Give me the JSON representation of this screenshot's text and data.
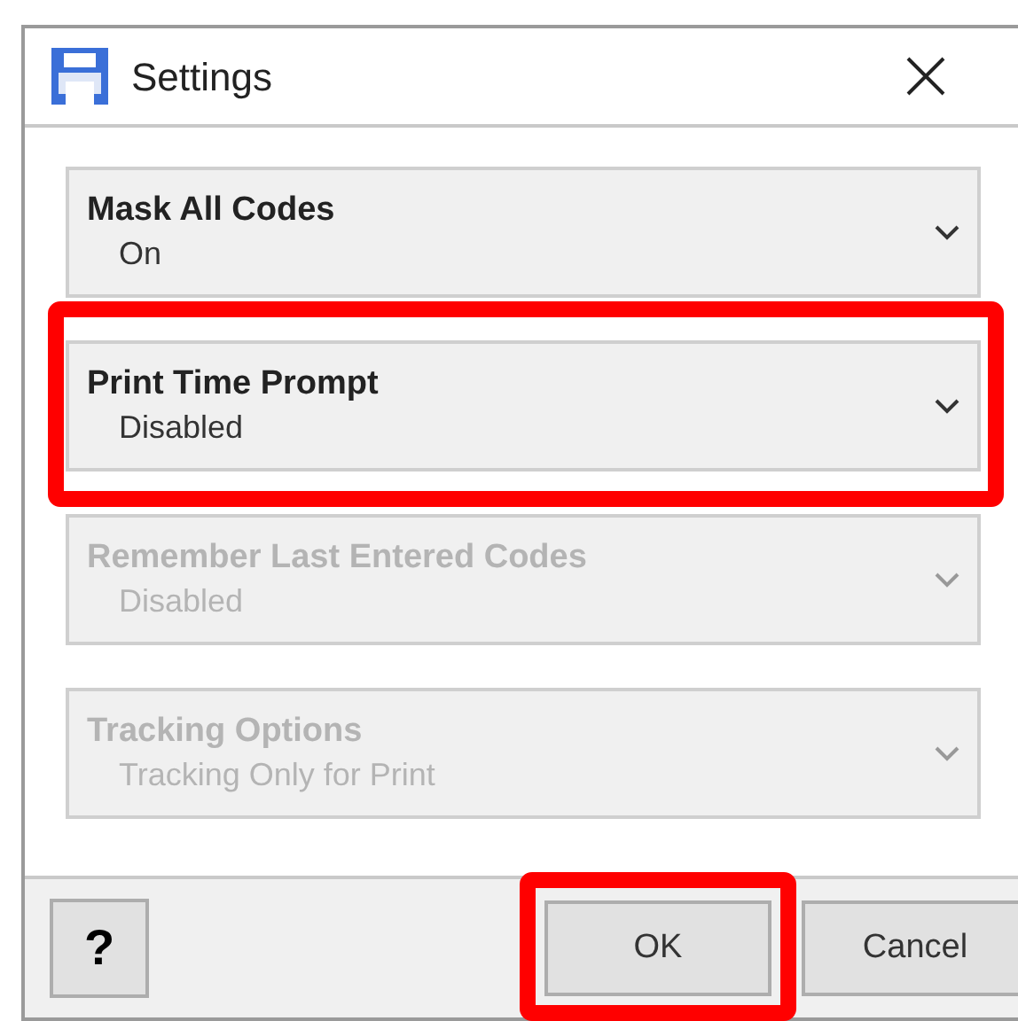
{
  "window": {
    "title": "Settings"
  },
  "settings": [
    {
      "label": "Mask All Codes",
      "value": "On",
      "disabled": false,
      "highlighted": false
    },
    {
      "label": "Print Time Prompt",
      "value": "Disabled",
      "disabled": false,
      "highlighted": true
    },
    {
      "label": "Remember Last Entered Codes",
      "value": "Disabled",
      "disabled": true,
      "highlighted": false
    },
    {
      "label": "Tracking Options",
      "value": "Tracking Only for Print",
      "disabled": true,
      "highlighted": false
    }
  ],
  "buttons": [
    {
      "kind": "help",
      "label": "?",
      "highlighted": false
    },
    {
      "kind": "action",
      "label": "OK",
      "highlighted": true
    },
    {
      "kind": "action",
      "label": "Cancel",
      "highlighted": false
    }
  ]
}
